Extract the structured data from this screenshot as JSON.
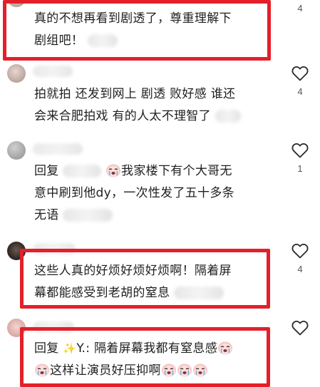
{
  "comments": [
    {
      "text_line1": "真的不想再看到剧透了，尊重理解下",
      "text_line2": "剧组吧！",
      "likes": "4",
      "highlighted": true
    },
    {
      "text_line1": "拍就拍 还发到网上 剧透 败好感 谁还",
      "text_line2": "会来合肥拍戏 有的人太不理智了",
      "likes": "4",
      "highlighted": false
    },
    {
      "reply_prefix": "回复",
      "text_line1": "我家楼下有个大哥无",
      "text_line2": "意中刷到他dy，一次性发了五十多条",
      "text_line3": "无语",
      "likes": "1",
      "highlighted": false
    },
    {
      "text_line1": "这些人真的好烦好烦好烦啊！隔着屏",
      "text_line2": "幕都能感受到老胡的窒息",
      "likes": "4",
      "highlighted": true
    },
    {
      "reply_prefix": "回复",
      "reply_target": "Y.",
      "text_line1": ": 隔着屏幕我都有窒息感",
      "text_line2": "这样让演员好压抑啊",
      "likes": "",
      "highlighted": true
    }
  ],
  "icons": {
    "like": "heart-outline-icon",
    "emoji": "crying-face-icon",
    "sparkle": "sparkle-icon"
  },
  "colors": {
    "highlight_border": "#e3202a",
    "text": "#1f1f1f",
    "count": "#555555"
  }
}
